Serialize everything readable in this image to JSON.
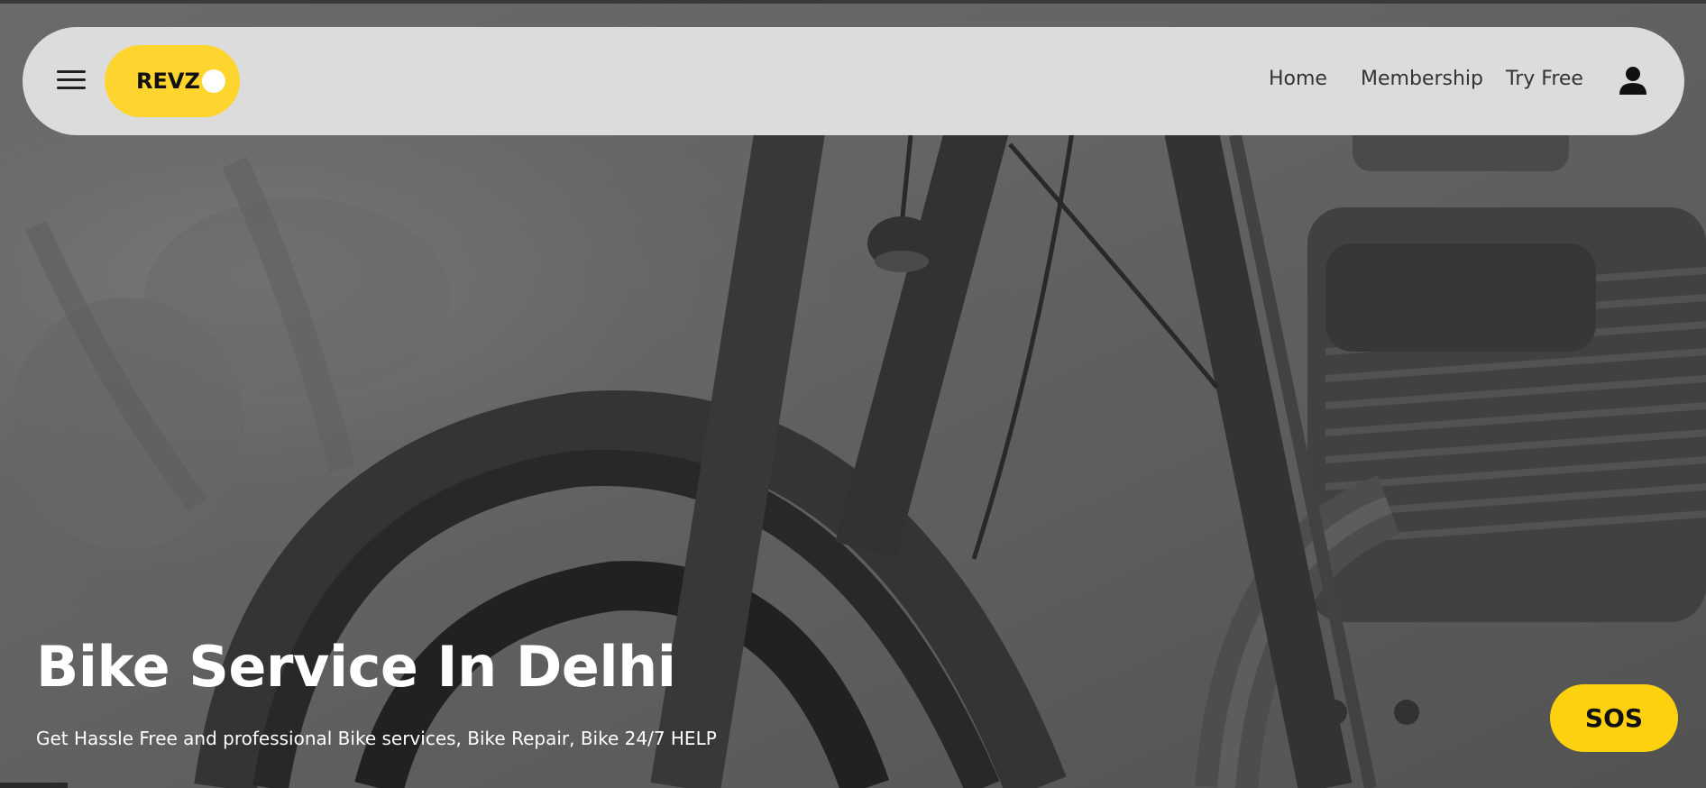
{
  "header": {
    "logo_text": "REVZ",
    "nav_links": [
      {
        "label": "Home"
      },
      {
        "label": "Membership"
      },
      {
        "label": "Try Free"
      }
    ],
    "menu_icon": "hamburger-menu-icon",
    "account_icon": "user-icon"
  },
  "hero": {
    "title": "Bike Service In Delhi",
    "subtitle": "Get Hassle Free and professional Bike services, Bike Repair, Bike 24/7 HELP",
    "background": "grayscale motorcycle close-up photo"
  },
  "sos": {
    "label": "SOS"
  },
  "colors": {
    "navbar_bg": "#dcdcdc",
    "accent_yellow": "#fed52e",
    "sos_yellow": "#fed10f",
    "hero_text": "#ffffff",
    "nav_text": "#333333"
  }
}
